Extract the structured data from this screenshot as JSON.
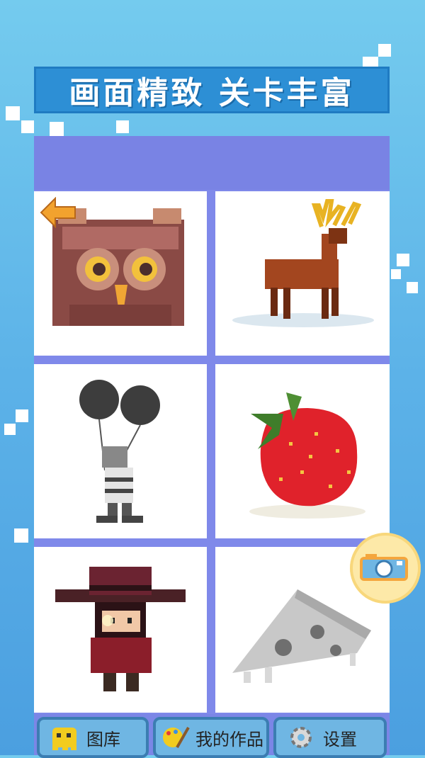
{
  "banner": {
    "title": "画面精致 关卡丰富"
  },
  "gallery": {
    "items": [
      {
        "name": "owl"
      },
      {
        "name": "deer"
      },
      {
        "name": "balloon-kid"
      },
      {
        "name": "strawberry"
      },
      {
        "name": "cowboy"
      },
      {
        "name": "pizza"
      }
    ]
  },
  "tabs": [
    {
      "label": "图库",
      "icon": "ghost-icon"
    },
    {
      "label": "我的作品",
      "icon": "palette-brush-icon"
    },
    {
      "label": "设置",
      "icon": "gear-icon"
    }
  ],
  "colors": {
    "accent": "#2d8fd5",
    "panel": "#7b86e6",
    "tab": "#6fb6e3"
  }
}
